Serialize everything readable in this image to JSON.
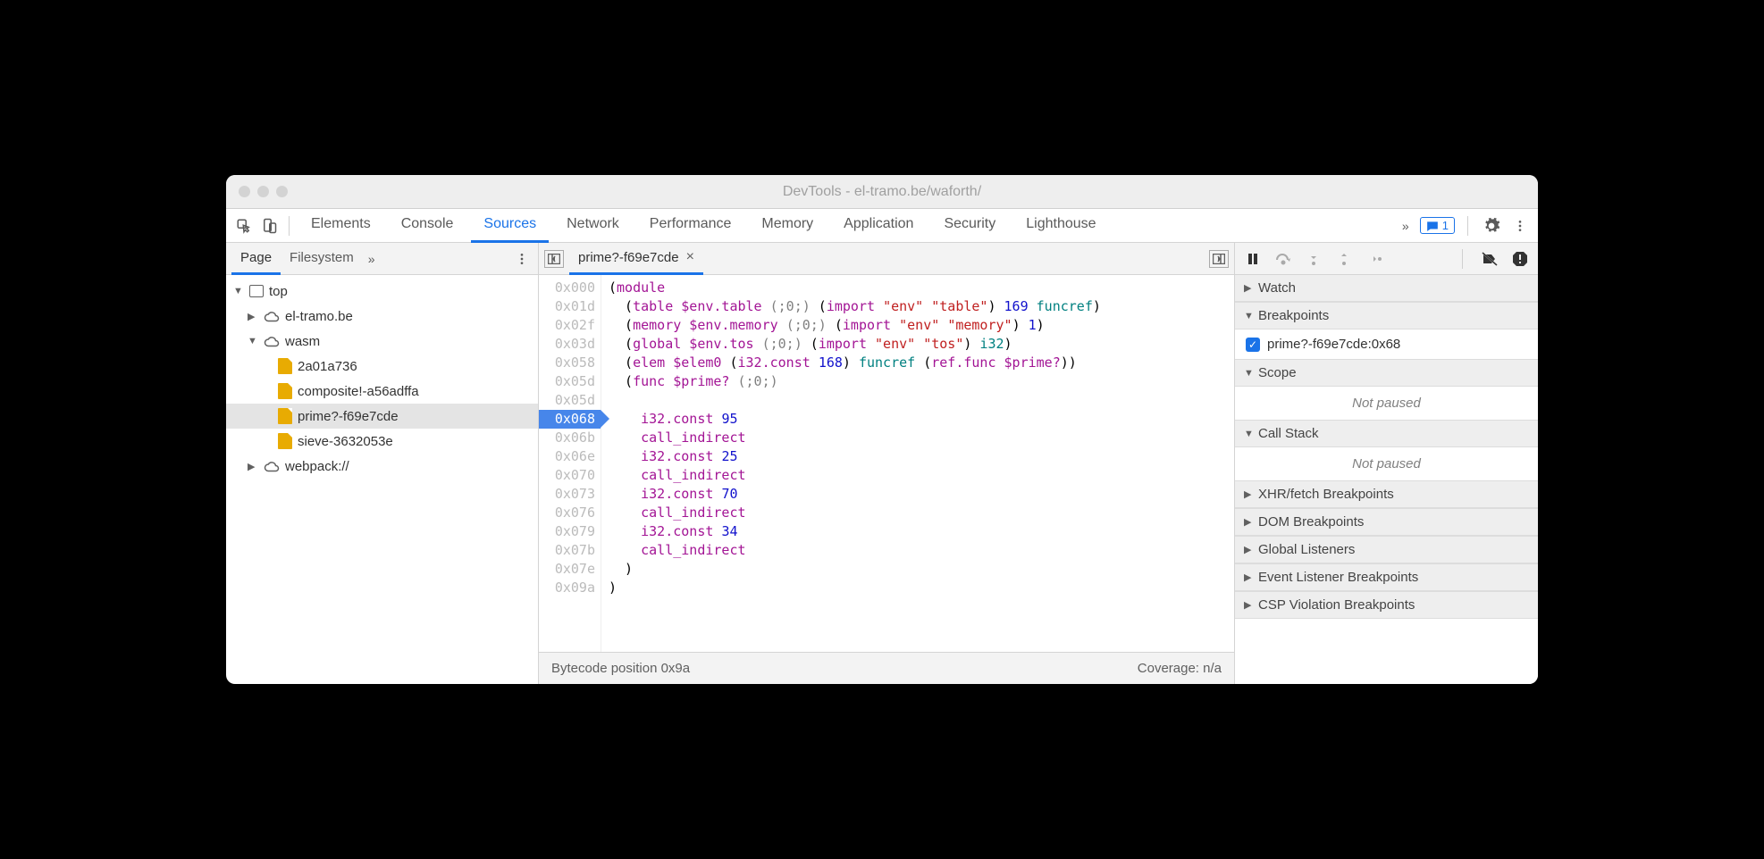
{
  "window_title": "DevTools - el-tramo.be/waforth/",
  "tabs": [
    "Elements",
    "Console",
    "Sources",
    "Network",
    "Performance",
    "Memory",
    "Application",
    "Security",
    "Lighthouse"
  ],
  "active_tab": "Sources",
  "messages_count": "1",
  "navigator": {
    "tabs": [
      "Page",
      "Filesystem"
    ],
    "active": "Page",
    "tree": [
      {
        "label": "top",
        "type": "frame",
        "indent": 0,
        "expanded": true
      },
      {
        "label": "el-tramo.be",
        "type": "cloud",
        "indent": 1,
        "expanded": false
      },
      {
        "label": "wasm",
        "type": "cloud",
        "indent": 1,
        "expanded": true
      },
      {
        "label": "2a01a736",
        "type": "file",
        "indent": 2
      },
      {
        "label": "composite!-a56adffa",
        "type": "file",
        "indent": 2
      },
      {
        "label": "prime?-f69e7cde",
        "type": "file",
        "indent": 2,
        "selected": true
      },
      {
        "label": "sieve-3632053e",
        "type": "file",
        "indent": 2
      },
      {
        "label": "webpack://",
        "type": "cloud",
        "indent": 1,
        "expanded": false
      }
    ]
  },
  "editor": {
    "tab_name": "prime?-f69e7cde",
    "status_left": "Bytecode position 0x9a",
    "status_right": "Coverage: n/a",
    "lines": [
      {
        "addr": "0x000",
        "bp": false,
        "tokens": [
          [
            "(",
            "paren"
          ],
          [
            "module",
            "kw"
          ]
        ]
      },
      {
        "addr": "0x01d",
        "bp": false,
        "tokens": [
          [
            "  (",
            "paren"
          ],
          [
            "table",
            "kw"
          ],
          [
            " $env.table ",
            "id"
          ],
          [
            "(;0;)",
            "cm"
          ],
          [
            " (",
            "paren"
          ],
          [
            "import",
            "kw"
          ],
          [
            " ",
            ""
          ],
          [
            "\"env\"",
            "str"
          ],
          [
            " ",
            ""
          ],
          [
            "\"table\"",
            "str"
          ],
          [
            ") ",
            "paren"
          ],
          [
            "169",
            "num"
          ],
          [
            " ",
            ""
          ],
          [
            "funcref",
            "type"
          ],
          [
            ")",
            "paren"
          ]
        ]
      },
      {
        "addr": "0x02f",
        "bp": false,
        "tokens": [
          [
            "  (",
            "paren"
          ],
          [
            "memory",
            "kw"
          ],
          [
            " $env.memory ",
            "id"
          ],
          [
            "(;0;)",
            "cm"
          ],
          [
            " (",
            "paren"
          ],
          [
            "import",
            "kw"
          ],
          [
            " ",
            ""
          ],
          [
            "\"env\"",
            "str"
          ],
          [
            " ",
            ""
          ],
          [
            "\"memory\"",
            "str"
          ],
          [
            ") ",
            "paren"
          ],
          [
            "1",
            "num"
          ],
          [
            ")",
            "paren"
          ]
        ]
      },
      {
        "addr": "0x03d",
        "bp": false,
        "tokens": [
          [
            "  (",
            "paren"
          ],
          [
            "global",
            "kw"
          ],
          [
            " $env.tos ",
            "id"
          ],
          [
            "(;0;)",
            "cm"
          ],
          [
            " (",
            "paren"
          ],
          [
            "import",
            "kw"
          ],
          [
            " ",
            ""
          ],
          [
            "\"env\"",
            "str"
          ],
          [
            " ",
            ""
          ],
          [
            "\"tos\"",
            "str"
          ],
          [
            ") ",
            "paren"
          ],
          [
            "i32",
            "type"
          ],
          [
            ")",
            "paren"
          ]
        ]
      },
      {
        "addr": "0x058",
        "bp": false,
        "tokens": [
          [
            "  (",
            "paren"
          ],
          [
            "elem",
            "kw"
          ],
          [
            " $elem0 ",
            "id"
          ],
          [
            "(",
            "paren"
          ],
          [
            "i32.const",
            "kw"
          ],
          [
            " ",
            ""
          ],
          [
            "168",
            "num"
          ],
          [
            ") ",
            "paren"
          ],
          [
            "funcref",
            "type"
          ],
          [
            " (",
            "paren"
          ],
          [
            "ref.func",
            "kw"
          ],
          [
            " $prime?",
            "id"
          ],
          [
            "))",
            "paren"
          ]
        ]
      },
      {
        "addr": "0x05d",
        "bp": false,
        "tokens": [
          [
            "  (",
            "paren"
          ],
          [
            "func",
            "kw"
          ],
          [
            " $prime? ",
            "id"
          ],
          [
            "(;0;)",
            "cm"
          ]
        ]
      },
      {
        "addr": "0x05d",
        "bp": false,
        "tokens": []
      },
      {
        "addr": "0x068",
        "bp": true,
        "tokens": [
          [
            "    ",
            ""
          ],
          [
            "i32.const",
            "kw"
          ],
          [
            " ",
            ""
          ],
          [
            "95",
            "num"
          ]
        ]
      },
      {
        "addr": "0x06b",
        "bp": false,
        "tokens": [
          [
            "    ",
            ""
          ],
          [
            "call_indirect",
            "kw"
          ]
        ]
      },
      {
        "addr": "0x06e",
        "bp": false,
        "tokens": [
          [
            "    ",
            ""
          ],
          [
            "i32.const",
            "kw"
          ],
          [
            " ",
            ""
          ],
          [
            "25",
            "num"
          ]
        ]
      },
      {
        "addr": "0x070",
        "bp": false,
        "tokens": [
          [
            "    ",
            ""
          ],
          [
            "call_indirect",
            "kw"
          ]
        ]
      },
      {
        "addr": "0x073",
        "bp": false,
        "tokens": [
          [
            "    ",
            ""
          ],
          [
            "i32.const",
            "kw"
          ],
          [
            " ",
            ""
          ],
          [
            "70",
            "num"
          ]
        ]
      },
      {
        "addr": "0x076",
        "bp": false,
        "tokens": [
          [
            "    ",
            ""
          ],
          [
            "call_indirect",
            "kw"
          ]
        ]
      },
      {
        "addr": "0x079",
        "bp": false,
        "tokens": [
          [
            "    ",
            ""
          ],
          [
            "i32.const",
            "kw"
          ],
          [
            " ",
            ""
          ],
          [
            "34",
            "num"
          ]
        ]
      },
      {
        "addr": "0x07b",
        "bp": false,
        "tokens": [
          [
            "    ",
            ""
          ],
          [
            "call_indirect",
            "kw"
          ]
        ]
      },
      {
        "addr": "0x07e",
        "bp": false,
        "tokens": [
          [
            "  )",
            "paren"
          ]
        ]
      },
      {
        "addr": "0x09a",
        "bp": false,
        "tokens": [
          [
            ")",
            "paren"
          ]
        ]
      }
    ]
  },
  "debugger": {
    "sections": [
      {
        "title": "Watch",
        "expanded": false
      },
      {
        "title": "Breakpoints",
        "expanded": true,
        "items": [
          "prime?-f69e7cde:0x68"
        ]
      },
      {
        "title": "Scope",
        "expanded": true,
        "body": "Not paused"
      },
      {
        "title": "Call Stack",
        "expanded": true,
        "body": "Not paused"
      },
      {
        "title": "XHR/fetch Breakpoints",
        "expanded": false
      },
      {
        "title": "DOM Breakpoints",
        "expanded": false
      },
      {
        "title": "Global Listeners",
        "expanded": false
      },
      {
        "title": "Event Listener Breakpoints",
        "expanded": false
      },
      {
        "title": "CSP Violation Breakpoints",
        "expanded": false
      }
    ]
  }
}
